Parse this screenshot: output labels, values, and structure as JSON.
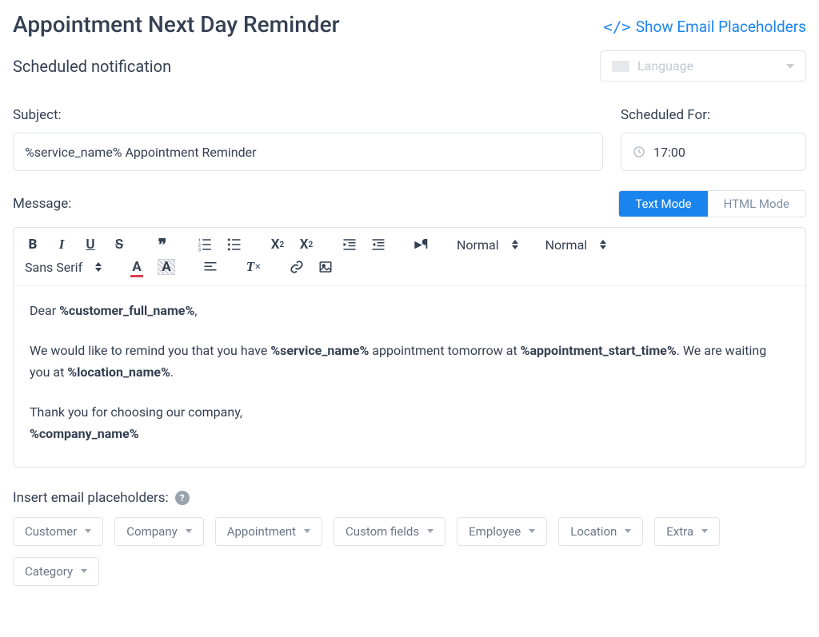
{
  "header": {
    "title": "Appointment Next Day Reminder",
    "show_placeholders_label": "Show Email Placeholders",
    "subtitle": "Scheduled notification",
    "language_placeholder": "Language"
  },
  "fields": {
    "subject_label": "Subject:",
    "subject_value": "%service_name% Appointment Reminder",
    "scheduled_label": "Scheduled For:",
    "scheduled_value": "17:00"
  },
  "message": {
    "label": "Message:",
    "mode_text": "Text Mode",
    "mode_html": "HTML Mode",
    "toolbar": {
      "heading_picker": "Normal",
      "size_picker": "Normal",
      "font_picker": "Sans Serif"
    },
    "body": {
      "greeting_prefix": "Dear ",
      "customer_ph": "%customer_full_name%",
      "greeting_suffix": ",",
      "p2_a": "We would like to remind you that you have ",
      "service_ph": "%service_name%",
      "p2_b": " appointment tomorrow at ",
      "start_time_ph": "%appointment_start_time%",
      "p2_c": ". We are waiting you at ",
      "location_ph": "%location_name%",
      "p2_d": ".",
      "p3": "Thank you for choosing our company,",
      "company_ph": "%company_name%"
    }
  },
  "placeholders": {
    "label": "Insert email placeholders:",
    "buttons": [
      "Customer",
      "Company",
      "Appointment",
      "Custom fields",
      "Employee",
      "Location",
      "Extra",
      "Category"
    ]
  }
}
